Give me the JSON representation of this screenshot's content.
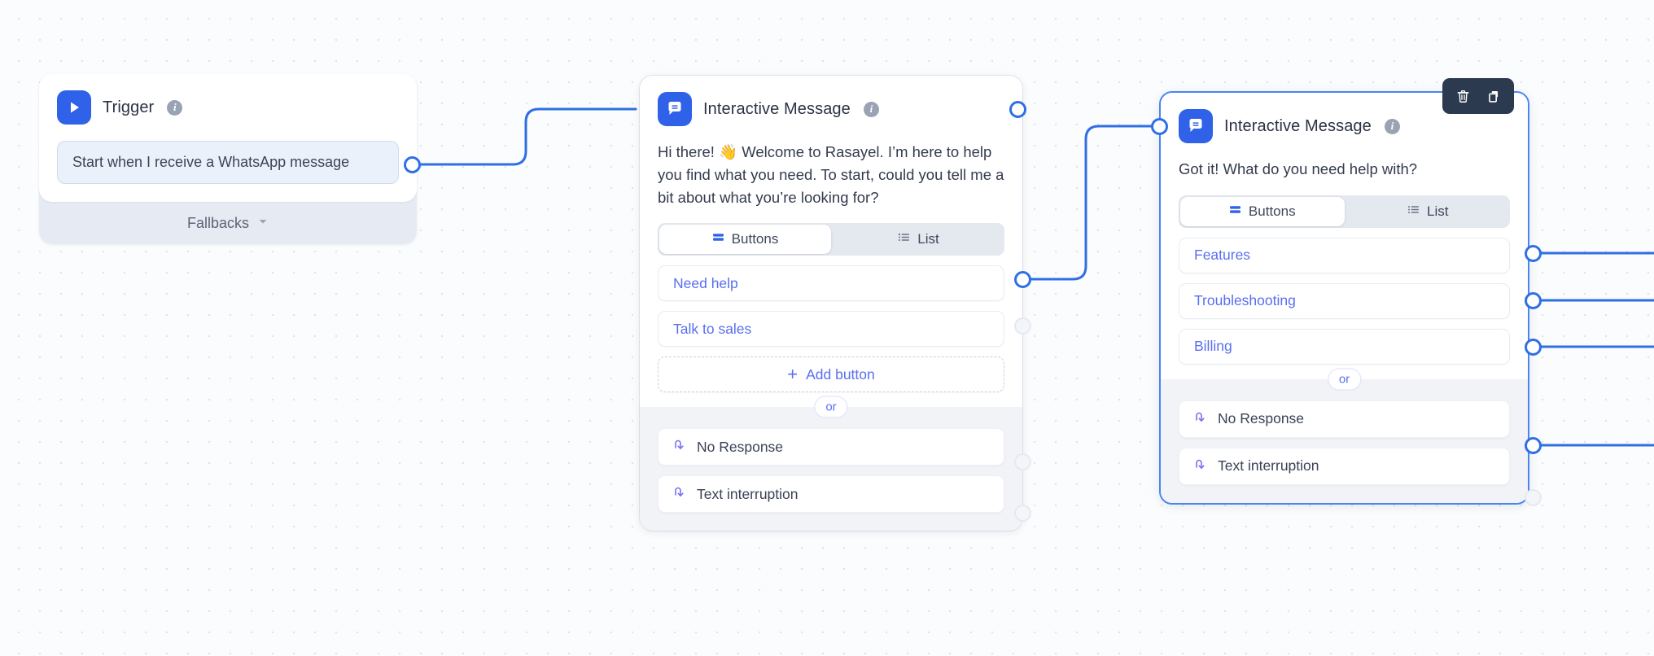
{
  "canvas": {
    "background_color": "#fbfcfd",
    "dot_color": "#dfe3ea",
    "edge_color": "#2f6fe4",
    "accent_color": "#2f62e8",
    "option_text_color": "#5a6ff0"
  },
  "nodes": {
    "trigger": {
      "icon": "play-icon",
      "title": "Trigger",
      "info_icon": "info-icon",
      "info_glyph": "i",
      "field_value": "Start when I receive a WhatsApp message",
      "fallbacks_label": "Fallbacks",
      "fallbacks_chevron": "chevron-down-icon"
    },
    "interactive_message_1": {
      "icon": "interactive-message-icon",
      "title": "Interactive Message",
      "info_icon": "info-icon",
      "info_glyph": "i",
      "message": "Hi there! 👋 Welcome to Rasayel. I’m here to help you find what you need. To start, could you tell me a bit about what you’re looking for?",
      "tabs": [
        {
          "label": "Buttons",
          "icon": "rows-icon",
          "active": true
        },
        {
          "label": "List",
          "icon": "list-icon",
          "active": false
        }
      ],
      "options": [
        {
          "label": "Need help",
          "connected": true
        },
        {
          "label": "Talk to sales",
          "connected": false
        }
      ],
      "add_button_label": "Add button",
      "add_button_icon": "plus-icon",
      "or_label": "or",
      "fallbacks": [
        {
          "label": "No Response",
          "icon": "uturn-arrow-icon",
          "connected": false
        },
        {
          "label": "Text interruption",
          "icon": "uturn-arrow-icon",
          "connected": false
        }
      ]
    },
    "interactive_message_2": {
      "icon": "interactive-message-icon",
      "title": "Interactive Message",
      "info_icon": "info-icon",
      "info_glyph": "i",
      "selected": true,
      "message": "Got it! What do you need help with?",
      "tabs": [
        {
          "label": "Buttons",
          "icon": "rows-icon",
          "active": true
        },
        {
          "label": "List",
          "icon": "list-icon",
          "active": false
        }
      ],
      "options": [
        {
          "label": "Features",
          "connected": true
        },
        {
          "label": "Troubleshooting",
          "connected": true
        },
        {
          "label": "Billing",
          "connected": true
        }
      ],
      "or_label": "or",
      "fallbacks": [
        {
          "label": "No Response",
          "icon": "uturn-arrow-icon",
          "connected": true
        },
        {
          "label": "Text interruption",
          "icon": "uturn-arrow-icon",
          "connected": false
        }
      ]
    }
  },
  "toolbar": {
    "delete_icon": "trash-icon",
    "duplicate_icon": "duplicate-icon",
    "background_color": "#2c3a4f"
  }
}
